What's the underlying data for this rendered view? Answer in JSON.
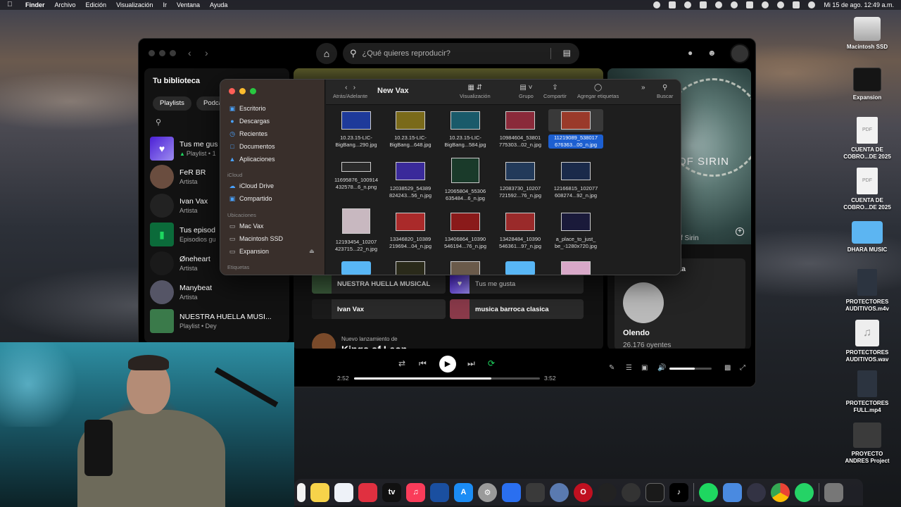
{
  "menubar": {
    "app": "Finder",
    "items": [
      "Archivo",
      "Edición",
      "Visualización",
      "Ir",
      "Ventana",
      "Ayuda"
    ],
    "datetime": "Mi 15 de ago.  12:49 a.m."
  },
  "spotify": {
    "search_placeholder": "¿Qué quieres reproducir?",
    "library": {
      "title": "Tu biblioteca",
      "chips": [
        "Playlists",
        "Podcas"
      ],
      "items": [
        {
          "name": "Tus me gus",
          "sub": "Playlist • 1"
        },
        {
          "name": "FeR BR",
          "sub": "Artista"
        },
        {
          "name": "Ivan Vax",
          "sub": "Artista"
        },
        {
          "name": "Tus episod",
          "sub": "Episodios gu"
        },
        {
          "name": "Øneheart",
          "sub": "Artista"
        },
        {
          "name": "Manybeat",
          "sub": "Artista"
        },
        {
          "name": "NUESTRA HUELLA MUSI...",
          "sub": "Playlist • Dey"
        }
      ]
    },
    "main": {
      "tiles": [
        "NUESTRA HUELLA MUSICAL",
        "Tus me gusta",
        "Ivan Vax",
        "musica barroca clasica"
      ],
      "new_release_label": "Nuevo lanzamiento de",
      "new_release_artist": "Kings of Leon"
    },
    "now_playing": {
      "art_text": "OF SIRIN",
      "art_sub": "f Sirin",
      "card_label": "ta",
      "artist_name": "Olendo",
      "listeners": "26.176 oyentes"
    },
    "player": {
      "elapsed": "2:52",
      "total": "3:52",
      "progress": 0.74,
      "volume": 0.6
    }
  },
  "finder": {
    "title": "New Vax",
    "toolbar": {
      "back_forward": "Atrás/Adelante",
      "view": "Visualización",
      "group": "Grupo",
      "share": "Compartir",
      "tags": "Agregar etiquetas",
      "search": "Buscar"
    },
    "sidebar": {
      "favorites": [
        "Escritorio",
        "Descargas",
        "Recientes",
        "Documentos",
        "Aplicaciones"
      ],
      "icloud_label": "iCloud",
      "icloud": [
        "iCloud Drive",
        "Compartido"
      ],
      "locations_label": "Ubicaciones",
      "locations": [
        "Mac Vax",
        "Macintosh SSD",
        "Expansion"
      ],
      "tags_label": "Etiquetas"
    },
    "files": [
      {
        "line1": "10.23.15-LIC-",
        "line2": "BigBang...290.jpg"
      },
      {
        "line1": "10.23.15-LIC-",
        "line2": "BigBang...648.jpg"
      },
      {
        "line1": "10.23.15-LIC-",
        "line2": "BigBang...584.jpg"
      },
      {
        "line1": "10984604_53801",
        "line2": "775303...02_n.jpg"
      },
      {
        "line1": "11219089_538017",
        "line2": "676363...00_n.jpg"
      },
      {
        "line1": "11695876_100914",
        "line2": "432578...6_n.png"
      },
      {
        "line1": "12038529_54389",
        "line2": "824243...56_n.jpg"
      },
      {
        "line1": "12065804_55306",
        "line2": "635484...6_n.jpg"
      },
      {
        "line1": "12083730_10207",
        "line2": "721592...76_n.jpg"
      },
      {
        "line1": "12166815_102077",
        "line2": "608274...92_n.jpg"
      },
      {
        "line1": "12193454_10207",
        "line2": "423715...22_n.jpg"
      },
      {
        "line1": "13346820_10389",
        "line2": "219694...04_n.jpg"
      },
      {
        "line1": "13406864_10390",
        "line2": "546194...76_n.jpg"
      },
      {
        "line1": "13428484_10390",
        "line2": "546361...97_n.jpg"
      },
      {
        "line1": "a_place_to_just_",
        "line2": "be_-1280x720.jpg"
      }
    ]
  },
  "desktop": {
    "icons": [
      {
        "line1": "Macintosh SSD",
        "line2": ""
      },
      {
        "line1": "Expansion",
        "line2": ""
      },
      {
        "line1": "CUENTA DE",
        "line2": "COBRO...DE 2025"
      },
      {
        "line1": "CUENTA DE",
        "line2": "COBRO...DE 2025"
      },
      {
        "line1": "DHARA MUSIC",
        "line2": ""
      },
      {
        "line1": "PROTECTORES",
        "line2": "AUDITIVOS.m4v"
      },
      {
        "line1": "PROTECTORES",
        "line2": "AUDITIVOS.wav"
      },
      {
        "line1": "PROTECTORES",
        "line2": "FULL.mp4"
      },
      {
        "line1": "PROYECTO",
        "line2": "ANDRES Project"
      }
    ]
  },
  "colors": {
    "spotify_green": "#1ed760",
    "selection_blue": "#1c5fd1",
    "folder_blue": "#5cb5f2"
  }
}
